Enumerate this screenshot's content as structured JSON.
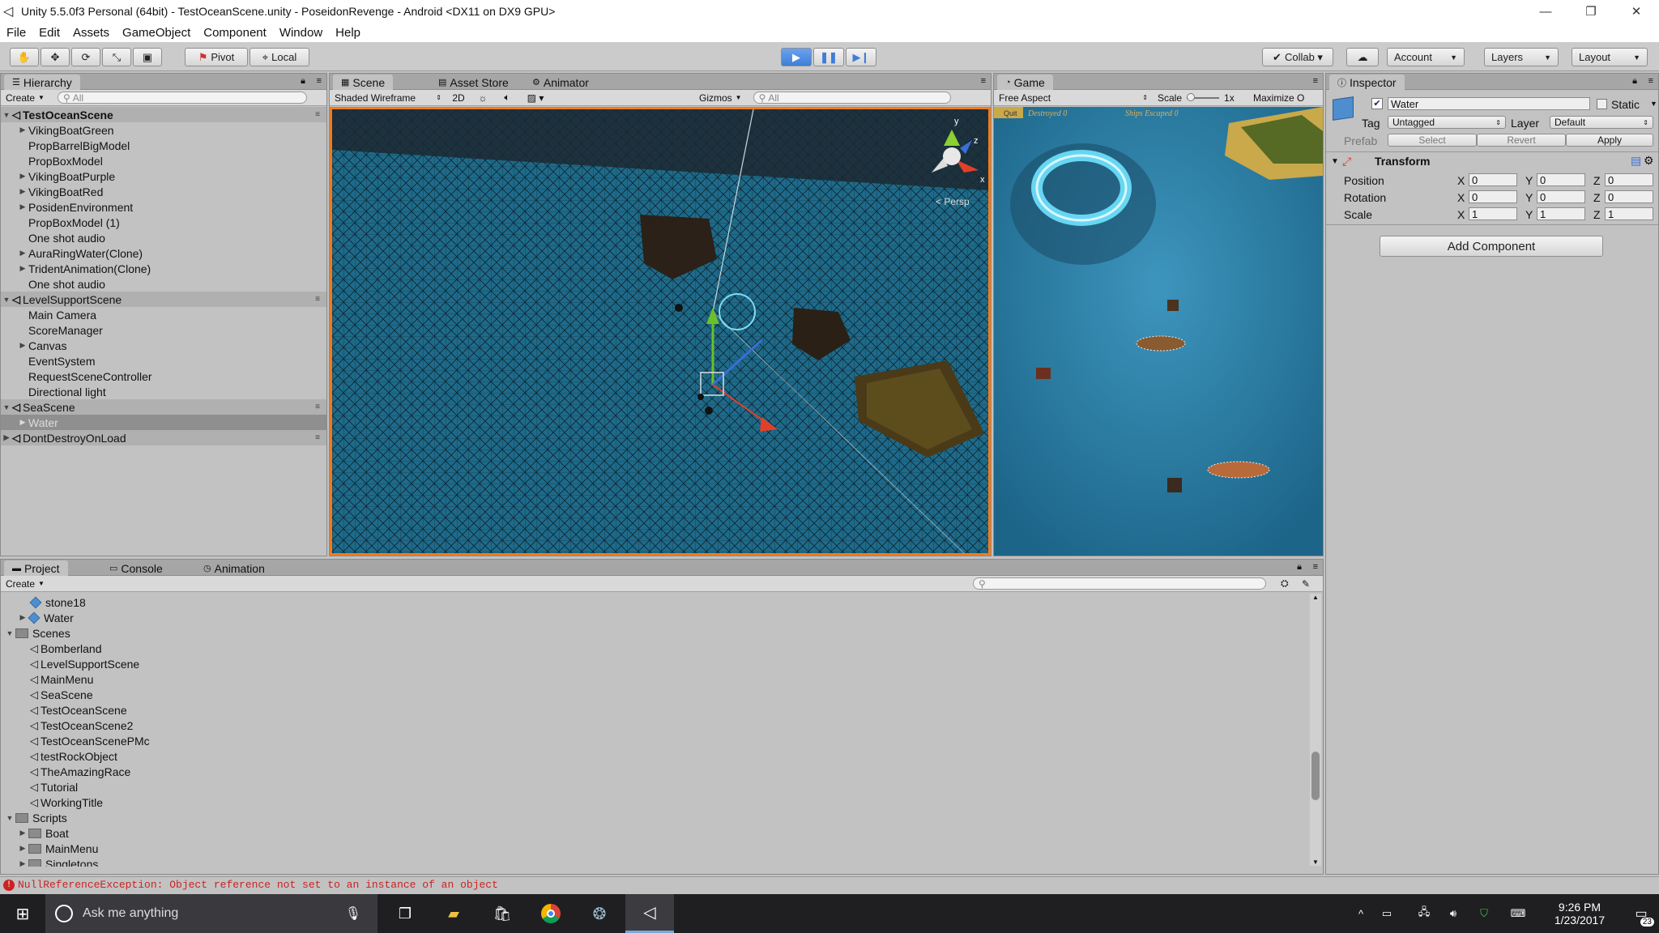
{
  "window": {
    "title": "Unity 5.5.0f3 Personal (64bit) - TestOceanScene.unity - PoseidonRevenge - Android <DX11 on DX9 GPU>",
    "minimize": "—",
    "restore": "❐",
    "close": "✕"
  },
  "menu": [
    "File",
    "Edit",
    "Assets",
    "GameObject",
    "Component",
    "Window",
    "Help"
  ],
  "toolbar": {
    "pivot": "Pivot",
    "local": "Local",
    "collab": "Collab ▾",
    "account": "Account",
    "layers": "Layers",
    "layout": "Layout"
  },
  "hierarchy": {
    "tab": "Hierarchy",
    "create": "Create",
    "search_placeholder": "All",
    "rows": [
      {
        "label": "TestOceanScene"
      },
      {
        "label": "VikingBoatGreen"
      },
      {
        "label": "PropBarrelBigModel"
      },
      {
        "label": "PropBoxModel"
      },
      {
        "label": "VikingBoatPurple"
      },
      {
        "label": "VikingBoatRed"
      },
      {
        "label": "PosidenEnvironment"
      },
      {
        "label": "PropBoxModel (1)"
      },
      {
        "label": "One shot audio"
      },
      {
        "label": "AuraRingWater(Clone)"
      },
      {
        "label": "TridentAnimation(Clone)"
      },
      {
        "label": "One shot audio"
      },
      {
        "label": "LevelSupportScene"
      },
      {
        "label": "Main Camera"
      },
      {
        "label": "ScoreManager"
      },
      {
        "label": "Canvas"
      },
      {
        "label": "EventSystem"
      },
      {
        "label": "RequestSceneController"
      },
      {
        "label": "Directional light"
      },
      {
        "label": "SeaScene"
      },
      {
        "label": "Water"
      },
      {
        "label": "DontDestroyOnLoad"
      }
    ]
  },
  "scene": {
    "tabs": [
      "Scene",
      "Asset Store",
      "Animator"
    ],
    "shading": "Shaded Wireframe",
    "mode2d": "2D",
    "gizmos": "Gizmos",
    "search_placeholder": "All",
    "persp": "< Persp",
    "axis_y": "y",
    "axis_x": "x",
    "axis_z": "z"
  },
  "game": {
    "tab": "Game",
    "aspect": "Free Aspect",
    "scale_label": "Scale",
    "scale_value": "1x",
    "maximize": "Maximize O",
    "hud_destroyed": "Destroyed 0",
    "hud_escaped": "Ships Escaped 0",
    "hud_quit": "Quit"
  },
  "inspector": {
    "tab": "Inspector",
    "object_name": "Water",
    "static_label": "Static",
    "tag_label": "Tag",
    "tag_value": "Untagged",
    "layer_label": "Layer",
    "layer_value": "Default",
    "prefab_label": "Prefab",
    "select": "Select",
    "revert": "Revert",
    "apply": "Apply",
    "transform_title": "Transform",
    "position_label": "Position",
    "rotation_label": "Rotation",
    "scale_label": "Scale",
    "position": {
      "x": "0",
      "y": "0",
      "z": "0"
    },
    "rotation": {
      "x": "0",
      "y": "0",
      "z": "0"
    },
    "scale": {
      "x": "1",
      "y": "1",
      "z": "1"
    },
    "add_component": "Add Component",
    "x": "X",
    "y": "Y",
    "z": "Z"
  },
  "project": {
    "tabs": [
      "Project",
      "Console",
      "Animation"
    ],
    "create": "Create",
    "items": [
      {
        "label": "stone18"
      },
      {
        "label": "Water"
      },
      {
        "label": "Scenes"
      },
      {
        "label": "Bomberland"
      },
      {
        "label": "LevelSupportScene"
      },
      {
        "label": "MainMenu"
      },
      {
        "label": "SeaScene"
      },
      {
        "label": "TestOceanScene"
      },
      {
        "label": "TestOceanScene2"
      },
      {
        "label": "TestOceanScenePMc"
      },
      {
        "label": "testRockObject"
      },
      {
        "label": "TheAmazingRace"
      },
      {
        "label": "Tutorial"
      },
      {
        "label": "WorkingTitle"
      },
      {
        "label": "Scripts"
      },
      {
        "label": "Boat"
      },
      {
        "label": "MainMenu"
      },
      {
        "label": "Singletons"
      }
    ]
  },
  "status": {
    "message": "NullReferenceException: Object reference not set to an instance of an object"
  },
  "taskbar": {
    "search_placeholder": "Ask me anything",
    "time": "9:26 PM",
    "date": "1/23/2017",
    "notifications": "23"
  },
  "colors": {
    "scene_border": "#f07b1c",
    "water_scene": "#1f6a8a",
    "water_game": "#2a7fa8",
    "play_blue": "#3e7ed8",
    "error_red": "#cc2222"
  }
}
